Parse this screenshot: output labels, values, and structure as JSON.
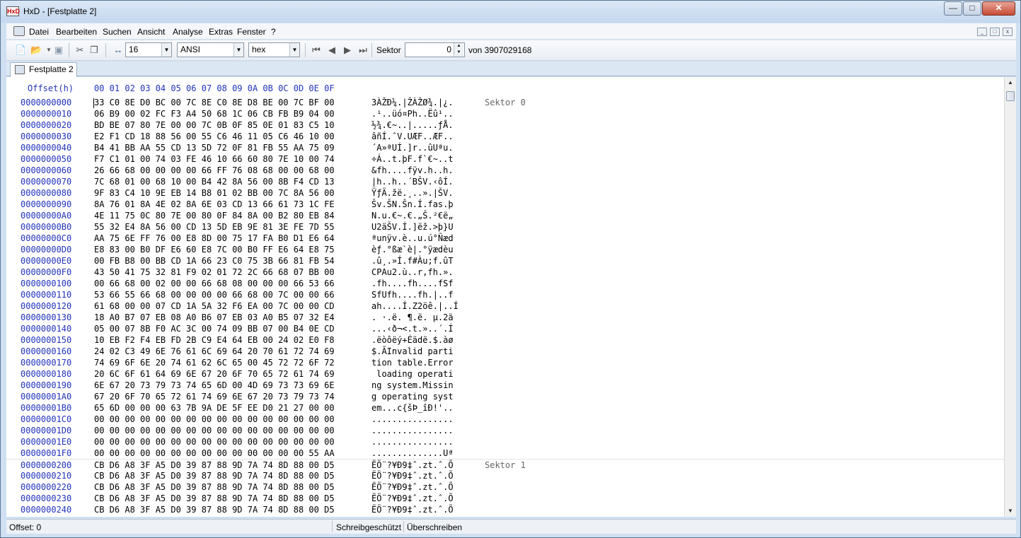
{
  "window": {
    "title": "HxD - [Festplatte 2]",
    "app_icon": "HxD",
    "minimize": "0",
    "maximize": "1",
    "close": "r"
  },
  "menu": [
    "Datei",
    "Bearbeiten",
    "Suchen",
    "Ansicht",
    "Analyse",
    "Extras",
    "Fenster",
    "?"
  ],
  "toolbar": {
    "bytes_per_row": "16",
    "charset": "ANSI",
    "offset_base": "hex",
    "sektor_label": "Sektor",
    "sektor_value": "0",
    "sektor_total": "von 3907029168"
  },
  "tab": {
    "label": "Festplatte 2"
  },
  "editor": {
    "offset_header": "Offset(h)",
    "columns": [
      "00",
      "01",
      "02",
      "03",
      "04",
      "05",
      "06",
      "07",
      "08",
      "09",
      "0A",
      "0B",
      "0C",
      "0D",
      "0E",
      "0F"
    ],
    "rows": [
      {
        "offset": "0000000000",
        "hex": "33 C0 8E D0 BC 00 7C 8E C0 8E D8 BE 00 7C BF 00",
        "text": "3ÀŽÐ¼.|ŽÀŽØ¾.|¿.",
        "sector": "Sektor 0"
      },
      {
        "offset": "0000000010",
        "hex": "06 B9 00 02 FC F3 A4 50 68 1C 06 CB FB B9 04 00",
        "text": ".¹..üó¤Ph..Ëû¹..",
        "sector": ""
      },
      {
        "offset": "0000000020",
        "hex": "BD BE 07 80 7E 00 00 7C 0B 0F 85 0E 01 83 C5 10",
        "text": "½¾.€~..|.....ƒÅ.",
        "sector": ""
      },
      {
        "offset": "0000000030",
        "hex": "E2 F1 CD 18 88 56 00 55 C6 46 11 05 C6 46 10 00",
        "text": "âñÍ.ˆV.UÆF..ÆF..",
        "sector": ""
      },
      {
        "offset": "0000000040",
        "hex": "B4 41 BB AA 55 CD 13 5D 72 0F 81 FB 55 AA 75 09",
        "text": "´A»ªUÍ.]r..ûUªu.",
        "sector": ""
      },
      {
        "offset": "0000000050",
        "hex": "F7 C1 01 00 74 03 FE 46 10 66 60 80 7E 10 00 74",
        "text": "÷Á..t.þF.f`€~..t",
        "sector": ""
      },
      {
        "offset": "0000000060",
        "hex": "26 66 68 00 00 00 00 66 FF 76 08 68 00 00 68 00",
        "text": "&fh....fÿv.h..h.",
        "sector": ""
      },
      {
        "offset": "0000000070",
        "hex": "7C 68 01 00 68 10 00 B4 42 8A 56 00 8B F4 CD 13",
        "text": "|h..h..´BŠV.‹ôÍ.",
        "sector": ""
      },
      {
        "offset": "0000000080",
        "hex": "9F 83 C4 10 9E EB 14 B8 01 02 BB 00 7C 8A 56 00",
        "text": "ŸƒÄ.žë.¸..».|ŠV.",
        "sector": ""
      },
      {
        "offset": "0000000090",
        "hex": "8A 76 01 8A 4E 02 8A 6E 03 CD 13 66 61 73 1C FE",
        "text": "Šv.ŠN.Šn.Í.fas.þ",
        "sector": ""
      },
      {
        "offset": "00000000A0",
        "hex": "4E 11 75 0C 80 7E 00 80 0F 84 8A 00 B2 80 EB 84",
        "text": "N.u.€~.€.„Š.²€ë„",
        "sector": ""
      },
      {
        "offset": "00000000B0",
        "hex": "55 32 E4 8A 56 00 CD 13 5D EB 9E 81 3E FE 7D 55",
        "text": "U2äŠV.Í.]ëž.>þ}U",
        "sector": ""
      },
      {
        "offset": "00000000C0",
        "hex": "AA 75 6E FF 76 00 E8 8D 00 75 17 FA B0 D1 E6 64",
        "text": "ªunÿv.è..u.ú°Ñæd",
        "sector": ""
      },
      {
        "offset": "00000000D0",
        "hex": "E8 83 00 B0 DF E6 60 E8 7C 00 B0 FF E6 64 E8 75",
        "text": "èƒ.°ßæ`è|.°ÿædèu",
        "sector": ""
      },
      {
        "offset": "00000000E0",
        "hex": "00 FB B8 00 BB CD 1A 66 23 C0 75 3B 66 81 FB 54",
        "text": ".û¸.»Í.f#Àu;f.ûT",
        "sector": ""
      },
      {
        "offset": "00000000F0",
        "hex": "43 50 41 75 32 81 F9 02 01 72 2C 66 68 07 BB 00",
        "text": "CPAu2.ù..r,fh.».",
        "sector": ""
      },
      {
        "offset": "0000000100",
        "hex": "00 66 68 00 02 00 00 66 68 08 00 00 00 66 53 66",
        "text": ".fh....fh....fSf",
        "sector": ""
      },
      {
        "offset": "0000000110",
        "hex": "53 66 55 66 68 00 00 00 00 66 68 00 7C 00 00 66",
        "text": "SfUfh....fh.|..f",
        "sector": ""
      },
      {
        "offset": "0000000120",
        "hex": "61 68 00 00 07 CD 1A 5A 32 F6 EA 00 7C 00 00 CD",
        "text": "ah....Í.Z2öê.|..Í",
        "sector": ""
      },
      {
        "offset": "0000000130",
        "hex": "18 A0 B7 07 EB 08 A0 B6 07 EB 03 A0 B5 07 32 E4",
        "text": ". ·.ë. ¶.ë. µ.2ä",
        "sector": ""
      },
      {
        "offset": "0000000140",
        "hex": "05 00 07 8B F0 AC 3C 00 74 09 BB 07 00 B4 0E CD",
        "text": "...‹ð¬<.t.»..´.Í",
        "sector": ""
      },
      {
        "offset": "0000000150",
        "hex": "10 EB F2 F4 EB FD 2B C9 E4 64 EB 00 24 02 E0 F8",
        "text": ".ëòôëý+Éädë.$.àø",
        "sector": ""
      },
      {
        "offset": "0000000160",
        "hex": "24 02 C3 49 6E 76 61 6C 69 64 20 70 61 72 74 69",
        "text": "$.ÃInvalid parti",
        "sector": ""
      },
      {
        "offset": "0000000170",
        "hex": "74 69 6F 6E 20 74 61 62 6C 65 00 45 72 72 6F 72",
        "text": "tion table.Error",
        "sector": ""
      },
      {
        "offset": "0000000180",
        "hex": "20 6C 6F 61 64 69 6E 67 20 6F 70 65 72 61 74 69",
        "text": " loading operati",
        "sector": ""
      },
      {
        "offset": "0000000190",
        "hex": "6E 67 20 73 79 73 74 65 6D 00 4D 69 73 73 69 6E",
        "text": "ng system.Missin",
        "sector": ""
      },
      {
        "offset": "00000001A0",
        "hex": "67 20 6F 70 65 72 61 74 69 6E 67 20 73 79 73 74",
        "text": "g operating syst",
        "sector": ""
      },
      {
        "offset": "00000001B0",
        "hex": "65 6D 00 00 00 63 7B 9A DE 5F EE D0 21 27 00 00",
        "text": "em...c{šÞ_îÐ!'..",
        "sector": ""
      },
      {
        "offset": "00000001C0",
        "hex": "00 00 00 00 00 00 00 00 00 00 00 00 00 00 00 00",
        "text": "................",
        "sector": ""
      },
      {
        "offset": "00000001D0",
        "hex": "00 00 00 00 00 00 00 00 00 00 00 00 00 00 00 00",
        "text": "................",
        "sector": ""
      },
      {
        "offset": "00000001E0",
        "hex": "00 00 00 00 00 00 00 00 00 00 00 00 00 00 00 00",
        "text": "................",
        "sector": ""
      },
      {
        "offset": "00000001F0",
        "hex": "00 00 00 00 00 00 00 00 00 00 00 00 00 00 55 AA",
        "text": "..............Uª",
        "sector": ""
      },
      {
        "offset": "0000000200",
        "hex": "CB D6 A8 3F A5 D0 39 87 88 9D 7A 74 8D 88 00 D5",
        "text": "ËÖ¨?¥Ð9‡ˆ.zt.ˆ.Õ",
        "sector": "Sektor 1"
      },
      {
        "offset": "0000000210",
        "hex": "CB D6 A8 3F A5 D0 39 87 88 9D 7A 74 8D 88 00 D5",
        "text": "ËÖ¨?¥Ð9‡ˆ.zt.ˆ.Õ",
        "sector": ""
      },
      {
        "offset": "0000000220",
        "hex": "CB D6 A8 3F A5 D0 39 87 88 9D 7A 74 8D 88 00 D5",
        "text": "ËÖ¨?¥Ð9‡ˆ.zt.ˆ.Õ",
        "sector": ""
      },
      {
        "offset": "0000000230",
        "hex": "CB D6 A8 3F A5 D0 39 87 88 9D 7A 74 8D 88 00 D5",
        "text": "ËÖ¨?¥Ð9‡ˆ.zt.ˆ.Õ",
        "sector": ""
      },
      {
        "offset": "0000000240",
        "hex": "CB D6 A8 3F A5 D0 39 87 88 9D 7A 74 8D 88 00 D5",
        "text": "ËÖ¨?¥Ð9‡ˆ.zt.ˆ.Õ",
        "sector": ""
      }
    ]
  },
  "status": {
    "offset": "Offset: 0",
    "readonly": "Schreibgeschützt",
    "mode": "Überschreiben"
  }
}
